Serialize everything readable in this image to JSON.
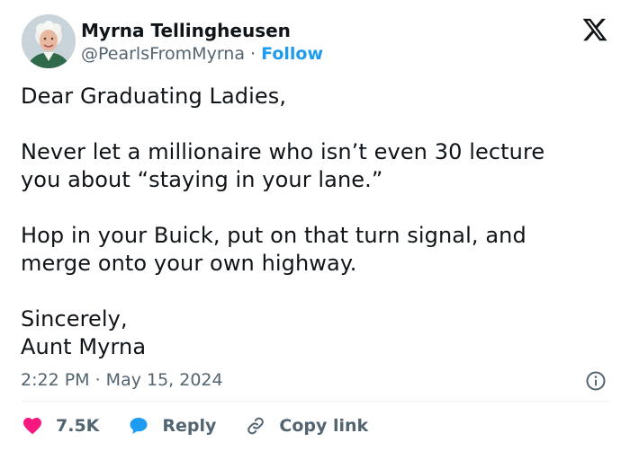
{
  "author": {
    "display_name": "Myrna Tellingheusen",
    "handle": "@PearlsFromMyrna",
    "separator": "·",
    "follow_label": "Follow"
  },
  "tweet": {
    "text": "Dear Graduating Ladies,\n\nNever let a millionaire who isn’t even 30 lecture\nyou about “staying in your lane.”\n\nHop in your Buick, put on that turn signal, and\nmerge onto your own highway.\n\nSincerely,\nAunt Myrna",
    "timestamp": "2:22 PM · May 15, 2024"
  },
  "actions": {
    "like_count": "7.5K",
    "reply_label": "Reply",
    "copy_link_label": "Copy link"
  },
  "icons": {
    "brand": "x-logo-icon",
    "info": "info-icon",
    "like": "heart-icon",
    "reply": "speech-bubble-icon",
    "copy_link": "link-icon"
  },
  "colors": {
    "text_primary": "#0f1419",
    "text_secondary": "#536471",
    "accent_blue": "#1d9bf0",
    "like_red": "#f91880"
  }
}
